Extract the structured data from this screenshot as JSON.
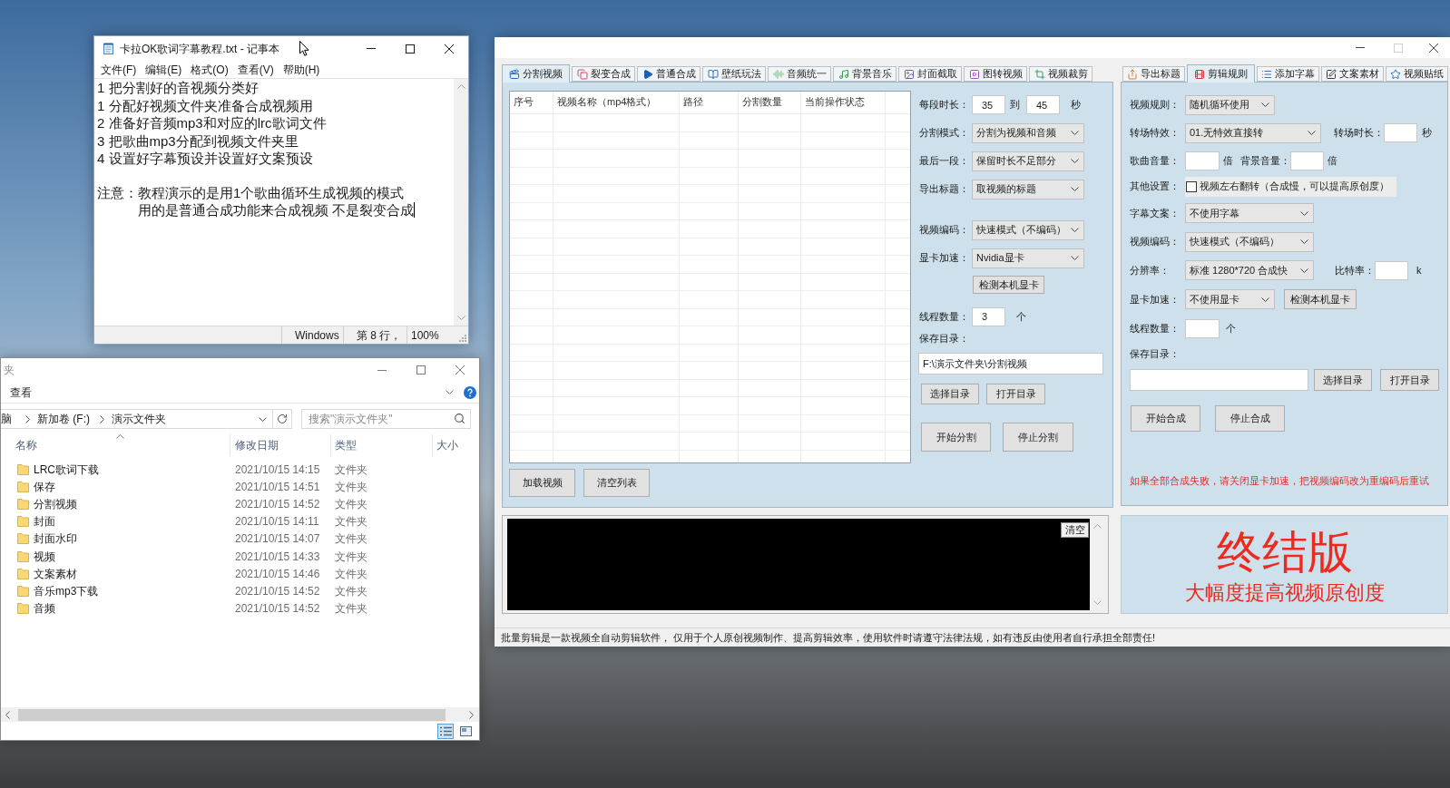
{
  "notepad": {
    "title": "卡拉OK歌词字幕教程.txt - 记事本",
    "menu": [
      "文件(F)",
      "编辑(E)",
      "格式(O)",
      "查看(V)",
      "帮助(H)"
    ],
    "lines": [
      "1 把分割好的音视频分类好",
      "1 分配好视频文件夹准备合成视频用",
      "2 准备好音频mp3和对应的lrc歌词文件",
      "3 把歌曲mp3分配到视频文件夹里",
      "4 设置好字幕预设并设置好文案预设"
    ],
    "note": {
      "label": "注意：",
      "lines": [
        "教程演示的是用1个歌曲循环生成视频的模式",
        "用的是普通合成功能来合成视频 不是裂变合成"
      ]
    },
    "status": {
      "encoding": "Windows",
      "position": "第 8 行，",
      "zoom": "100%"
    }
  },
  "explorer": {
    "title": "夹",
    "ribbon_tab": "查看",
    "breadcrumb": [
      "脑",
      "新加卷 (F:)",
      "演示文件夹"
    ],
    "search": {
      "placeholder": "搜索\"演示文件夹\""
    },
    "columns": [
      "名称",
      "修改日期",
      "类型",
      "大小"
    ],
    "rows": [
      {
        "name": "LRC歌词下载",
        "modified": "2021/10/15 14:15",
        "type": "文件夹"
      },
      {
        "name": "保存",
        "modified": "2021/10/15 14:51",
        "type": "文件夹"
      },
      {
        "name": "分割视频",
        "modified": "2021/10/15 14:52",
        "type": "文件夹"
      },
      {
        "name": "封面",
        "modified": "2021/10/15 14:11",
        "type": "文件夹"
      },
      {
        "name": "封面水印",
        "modified": "2021/10/15 14:07",
        "type": "文件夹"
      },
      {
        "name": "视频",
        "modified": "2021/10/15 14:33",
        "type": "文件夹"
      },
      {
        "name": "文案素材",
        "modified": "2021/10/15 14:46",
        "type": "文件夹"
      },
      {
        "name": "音乐mp3下载",
        "modified": "2021/10/15 14:52",
        "type": "文件夹"
      },
      {
        "name": "音频",
        "modified": "2021/10/15 14:52",
        "type": "文件夹"
      }
    ],
    "view_buttons": [
      {
        "kind": "details",
        "selected": true
      },
      {
        "kind": "tiles",
        "selected": false
      }
    ]
  },
  "app_window": {
    "controls": [
      {
        "kind": "minimize",
        "disabled": false
      },
      {
        "kind": "maximize",
        "disabled": true
      },
      {
        "kind": "close",
        "disabled": false
      }
    ]
  },
  "splitter": {
    "tabs": [
      {
        "label": "分割视频",
        "selected": true
      },
      {
        "label": "裂变合成",
        "selected": false
      },
      {
        "label": "普通合成",
        "selected": false
      },
      {
        "label": "壁纸玩法",
        "selected": false
      },
      {
        "label": "音频统一",
        "selected": false
      },
      {
        "label": "背景音乐",
        "selected": false
      },
      {
        "label": "封面截取",
        "selected": false
      },
      {
        "label": "图转视频",
        "selected": false
      },
      {
        "label": "视频裁剪",
        "selected": false
      }
    ],
    "table": {
      "columns": [
        "序号",
        "视频名称（mp4格式）",
        "路径",
        "分割数量",
        "当前操作状态"
      ]
    },
    "list_buttons": [
      "加载视频",
      "清空列表"
    ],
    "duration": {
      "label": "每段时长：",
      "from": "35",
      "to_label": "到",
      "to": "45",
      "unit": "秒"
    },
    "mode": {
      "label": "分割模式：",
      "value": "分割为视频和音频"
    },
    "last_segment": {
      "label": "最后一段：",
      "value": "保留时长不足部分"
    },
    "export_title": {
      "label": "导出标题：",
      "value": "取视频的标题"
    },
    "codec": {
      "label": "视频编码：",
      "value": "快速模式（不编码）"
    },
    "gpu": {
      "label": "显卡加速：",
      "value": "Nvidia显卡",
      "button": "检测本机显卡"
    },
    "threads": {
      "label": "线程数量：",
      "value": "3",
      "unit": "个"
    },
    "save_dir": {
      "label": "保存目录：",
      "value": "F:\\演示文件夹\\分割视频",
      "buttons": [
        "选择目录",
        "打开目录"
      ]
    },
    "action_buttons": [
      "开始分割",
      "停止分割"
    ]
  },
  "compose": {
    "tabs": [
      {
        "label": "导出标题",
        "selected": false
      },
      {
        "label": "剪辑规则",
        "selected": true
      },
      {
        "label": "添加字幕",
        "selected": false
      },
      {
        "label": "文案素材",
        "selected": false
      },
      {
        "label": "视频贴纸",
        "selected": false
      }
    ],
    "video_rule": {
      "label": "视频规则：",
      "value": "随机循环使用"
    },
    "transition": {
      "label": "转场特效：",
      "value": "01.无特效直接转",
      "duration_label": "转场时长：",
      "duration_unit": "秒"
    },
    "volume": {
      "song_label": "歌曲音量：",
      "song_unit": "倍",
      "bg_label": "背景音量：",
      "bg_unit": "倍"
    },
    "other": {
      "label": "其他设置：",
      "checkbox": {
        "label": "视频左右翻转（合成慢，可以提高原创度）",
        "checked": false
      }
    },
    "subtitle": {
      "label": "字幕文案：",
      "value": "不使用字幕"
    },
    "codec": {
      "label": "视频编码：",
      "value": "快速模式（不编码）"
    },
    "resolution": {
      "label": "分辨率：",
      "value": "标准 1280*720 合成快",
      "bitrate_label": "比特率：",
      "bitrate_unit": "k"
    },
    "gpu": {
      "label": "显卡加速：",
      "value": "不使用显卡",
      "button": "检测本机显卡"
    },
    "threads": {
      "label": "线程数量：",
      "unit": "个"
    },
    "save_dir": {
      "label": "保存目录：",
      "buttons": [
        "选择目录",
        "打开目录"
      ]
    },
    "action_buttons": [
      "开始合成",
      "停止合成"
    ],
    "warning": "如果全部合成失败，请关闭显卡加速，把视频编码改为重编码后重试"
  },
  "log": {
    "clear_button": "清空"
  },
  "banner": {
    "title": "终结版",
    "subtitle": "大幅度提高视频原创度"
  },
  "status_bar": "批量剪辑是一款视频全自动剪辑软件， 仅用于个人原创视频制作、提高剪辑效率，使用软件时请遵守法律法规，如有违反由使用者自行承担全部责任!"
}
